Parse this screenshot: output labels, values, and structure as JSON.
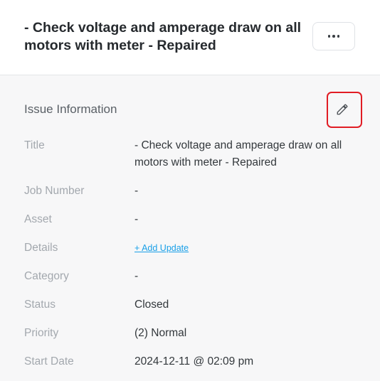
{
  "header": {
    "title": "- Check voltage and amperage draw on all motors with meter - Repaired",
    "more_button_label": "···"
  },
  "section": {
    "title": "Issue Information",
    "edit_icon": "pencil-icon",
    "highlight_color": "#e11c24"
  },
  "fields": [
    {
      "label": "Title",
      "value": "- Check voltage and amperage draw on all motors with meter - Repaired"
    },
    {
      "label": "Job Number",
      "value": "-"
    },
    {
      "label": "Asset",
      "value": "-"
    },
    {
      "label": "Details",
      "value": "+ Add Update"
    },
    {
      "label": "Category",
      "value": "-"
    },
    {
      "label": "Status",
      "value": "Closed"
    },
    {
      "label": "Priority",
      "value": "(2) Normal"
    },
    {
      "label": "Start Date",
      "value": "2024-12-11 @ 02:09 pm"
    }
  ],
  "colors": {
    "link": "#1aa0e8",
    "label": "#a3a8ae",
    "section_background": "#f7f7f8"
  }
}
